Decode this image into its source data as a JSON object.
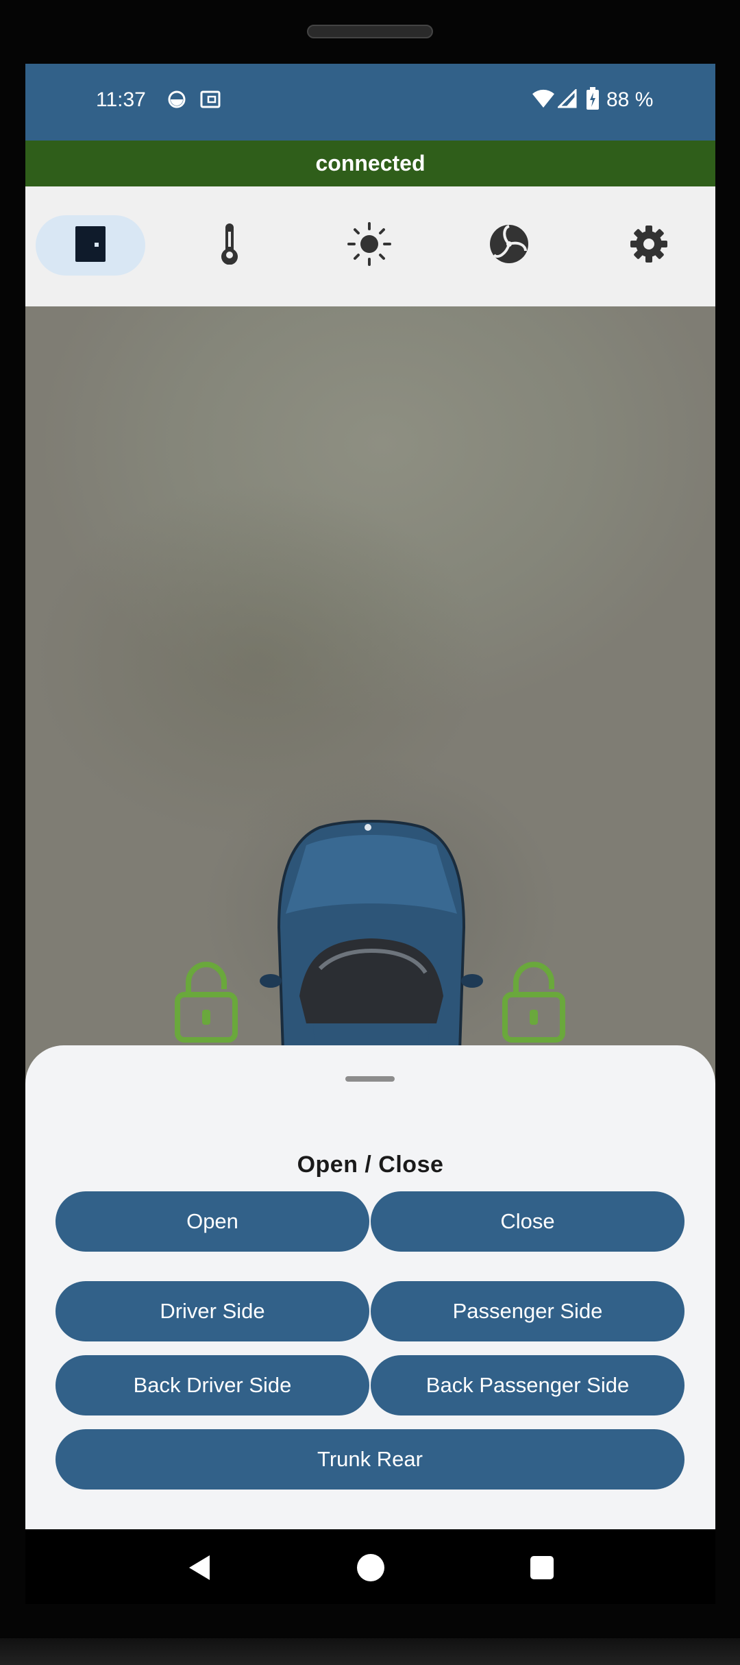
{
  "status_bar": {
    "time": "11:37",
    "battery": "88 %"
  },
  "connection": {
    "status": "connected",
    "color": "#2f5e1a"
  },
  "tabs": [
    {
      "icon": "door-icon",
      "active": true
    },
    {
      "icon": "thermometer-icon",
      "active": false
    },
    {
      "icon": "sun-icon",
      "active": false
    },
    {
      "icon": "fan-icon",
      "active": false
    },
    {
      "icon": "gear-icon",
      "active": false
    }
  ],
  "sheet": {
    "title": "Open / Close",
    "buttons": {
      "open": "Open",
      "close": "Close",
      "driver_side": "Driver Side",
      "passenger_side": "Passenger Side",
      "back_driver_side": "Back Driver Side",
      "back_passenger_side": "Back Passenger Side",
      "trunk_rear": "Trunk Rear"
    }
  },
  "colors": {
    "primary": "#326189",
    "lock_green": "#6aa83c",
    "active_tab": "#d9e7f4"
  }
}
